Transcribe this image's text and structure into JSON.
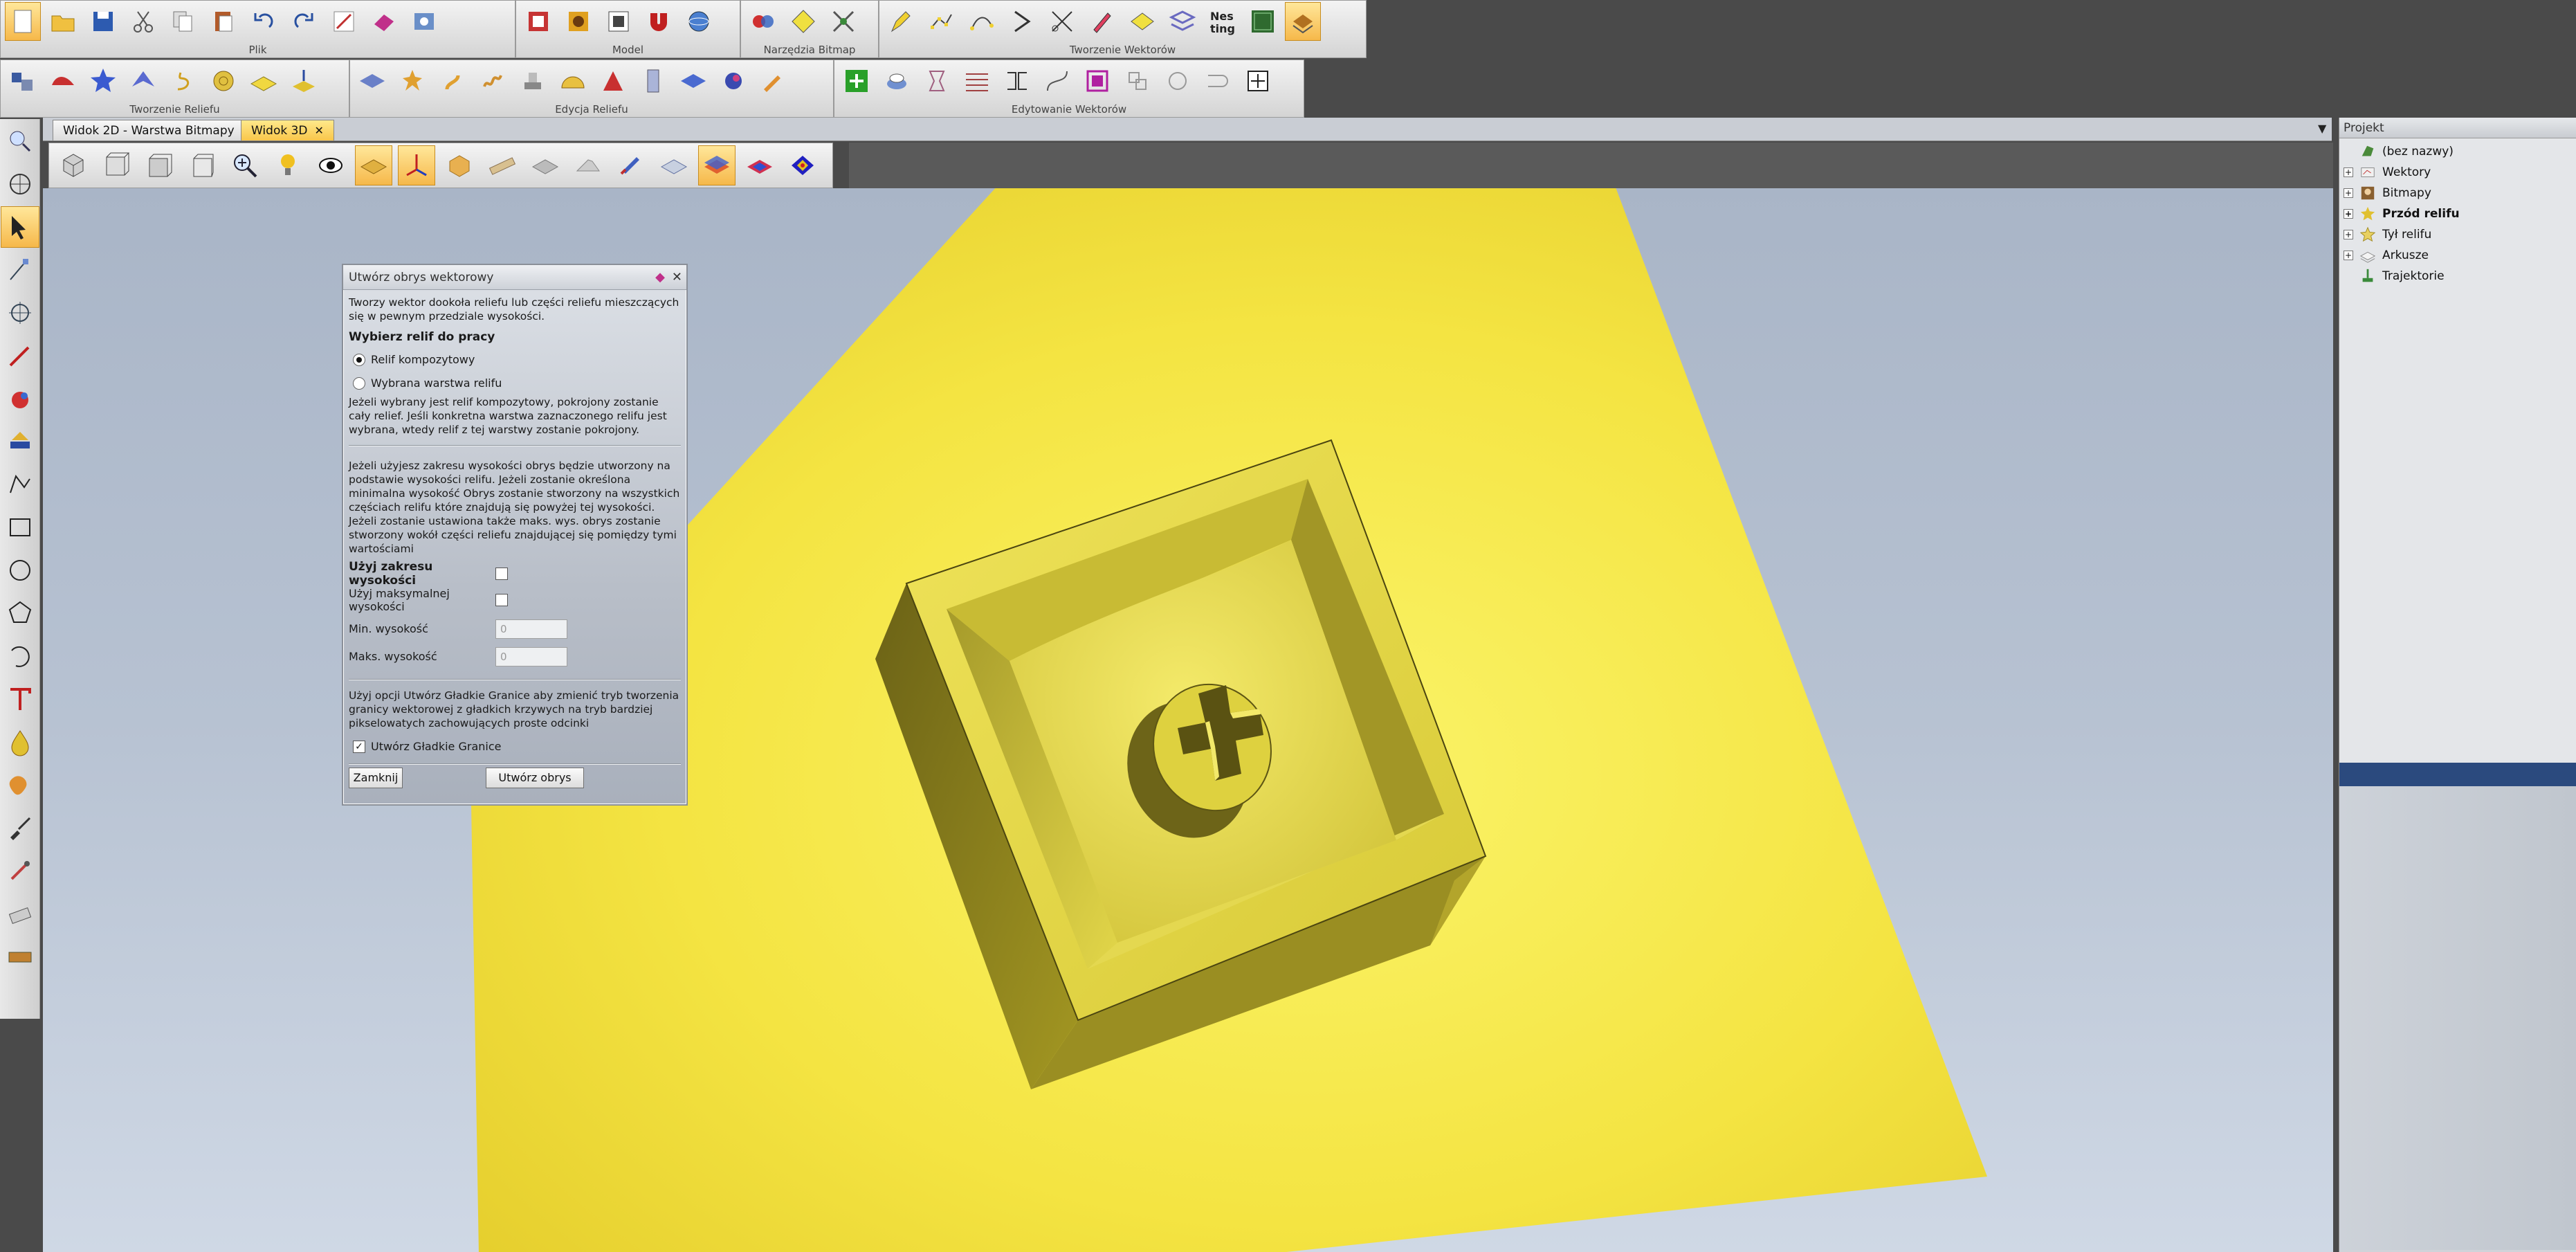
{
  "toolbar_top": {
    "groups": [
      {
        "label": "Plik",
        "icons": [
          "new-file-icon",
          "open-folder-icon",
          "save-icon",
          "cut-icon",
          "copy-icon",
          "paste-icon",
          "undo-icon",
          "redo-icon",
          "edit-icon",
          "eraser-icon",
          "settings-icon"
        ]
      },
      {
        "label": "Model",
        "icons": [
          "model-size-icon",
          "model-resolution-icon",
          "model-offset-icon",
          "model-magnet-icon",
          "model-sphere-icon"
        ]
      },
      {
        "label": "Narzędzia Bitmap",
        "icons": [
          "bitmap-color-icon",
          "bitmap-diamond-icon",
          "bitmap-tools-icon"
        ]
      },
      {
        "label": "Tworzenie Wektorów",
        "icons": [
          "vector-pen-icon",
          "vector-nodes-icon",
          "vector-path-icon",
          "vector-arrow-icon",
          "vector-cut-icon",
          "vector-draw-icon",
          "vector-shape-icon",
          "vector-weave-icon",
          "nesting-icon",
          "vector-text-icon",
          "vector-relief-icon"
        ]
      }
    ],
    "nesting_label": "Nes ting"
  },
  "toolbar_second": {
    "groups": [
      {
        "label": "Tworzenie Reliefu",
        "icons": [
          "relief-shapes-icon",
          "relief-wave-icon",
          "relief-star-icon",
          "relief-swept-icon",
          "relief-spiral-icon",
          "relief-texture-icon",
          "relief-plane-icon",
          "relief-extrude-icon"
        ]
      },
      {
        "label": "Edycja Reliefu",
        "icons": [
          "relief-flat-icon",
          "relief-sculpt-icon",
          "relief-smooth-icon",
          "relief-bevel-icon",
          "relief-stamp-icon",
          "relief-dome-icon",
          "relief-tilt-icon",
          "relief-pillar-icon",
          "relief-layer-icon",
          "relief-blend-icon",
          "relief-brush-icon"
        ]
      },
      {
        "label": "Edytowanie Wektorów",
        "icons": [
          "vector-boundary-icon",
          "vector-ring-icon",
          "vector-transform-icon",
          "vector-pattern-icon",
          "vector-join-icon",
          "vector-spline-icon",
          "vector-group-icon",
          "vector-intersect-icon",
          "vector-circle-icon",
          "vector-weld-icon",
          "vector-select-icon"
        ]
      }
    ]
  },
  "left_toolbar": {
    "icons": [
      "zoom-view-icon",
      "globe-icon",
      "select-arrow-icon",
      "node-edit-icon",
      "transform-icon",
      "pen-line-icon",
      "paint-bucket-icon",
      "paint-fill-icon",
      "polyline-icon",
      "rectangle-icon",
      "circle-icon",
      "polygon-icon",
      "arc-icon",
      "text-icon",
      "drop-icon",
      "blob-icon",
      "brush-icon",
      "dropper-icon",
      "eraser-icon",
      "ruler-icon"
    ]
  },
  "document_tabs": [
    {
      "label": "Widok 2D - Warstwa Bitmapy",
      "active": false
    },
    {
      "label": "Widok 3D",
      "active": true
    }
  ],
  "view3d_toolbar": {
    "icons": [
      "view-iso-icon",
      "view-top-icon",
      "view-front-icon",
      "view-side-icon",
      "zoom-icon",
      "light-icon",
      "eye-icon",
      "relief-shaded-icon",
      "axes-icon",
      "relief-box-icon",
      "ruler-bar-icon",
      "plane-icon",
      "gray-plane-icon",
      "brush-view-icon",
      "material-icon",
      "color-layer-icon",
      "rainbow-layer-icon",
      "rainbow-diamond-icon"
    ],
    "active_icons": [
      "relief-shaded-icon",
      "axes-icon",
      "color-layer-icon"
    ]
  },
  "dialog": {
    "title": "Utwórz obrys wektorowy",
    "intro": "Tworzy wektor dookoła reliefu lub części reliefu mieszczących się w pewnym przedziale wysokości.",
    "select_heading": "Wybierz relif do pracy",
    "radio_composite": "Relif kompozytowy",
    "radio_layer": "Wybrana warstwa relifu",
    "radio_selected": "composite",
    "select_info": "Jeżeli wybrany jest relif kompozytowy, pokrojony zostanie cały relief. Jeśli konkretna warstwa zaznaczonego relifu jest wybrana, wtedy relif z tej warstwy zostanie pokrojony.",
    "range_info": "Jeżeli użyjesz zakresu wysokości obrys będzie utworzony na podstawie wysokości relifu. Jeżeli zostanie określona minimalna wysokość Obrys zostanie stworzony na wszystkich częściach relifu które znajdują się powyżej tej wysokości. Jeżeli zostanie ustawiona także maks. wys. obrys zostanie stworzony wokół części reliefu znajdującej się pomiędzy tymi wartościami",
    "use_range_label": "Użyj zakresu wysokości",
    "use_range_checked": false,
    "use_max_label": "Użyj maksymalnej wysokości",
    "use_max_checked": false,
    "min_label": "Min. wysokość",
    "min_value": "0",
    "max_label": "Maks. wysokość",
    "max_value": "0",
    "smooth_info": "Użyj opcji Utwórz Gładkie Granice aby zmienić tryb tworzenia granicy wektorowej z gładkich krzywych na tryb bardziej pikselowatych zachowujących proste odcinki",
    "smooth_label": "Utwórz Gładkie Granice",
    "smooth_checked": true,
    "close_button": "Zamknij",
    "create_button": "Utwórz obrys"
  },
  "project_panel": {
    "title": "Projekt",
    "items": [
      {
        "label": "(bez nazwy)",
        "bold": false,
        "expandable": false,
        "icon": "project-root-icon"
      },
      {
        "label": "Wektory",
        "bold": false,
        "expandable": true,
        "icon": "vectors-folder-icon"
      },
      {
        "label": "Bitmapy",
        "bold": false,
        "expandable": true,
        "icon": "bitmaps-folder-icon"
      },
      {
        "label": "Przód relifu",
        "bold": true,
        "expandable": true,
        "icon": "relief-front-icon"
      },
      {
        "label": "Tył relifu",
        "bold": false,
        "expandable": true,
        "icon": "relief-back-icon"
      },
      {
        "label": "Arkusze",
        "bold": false,
        "expandable": true,
        "icon": "sheets-folder-icon"
      },
      {
        "label": "Trajektorie",
        "bold": false,
        "expandable": false,
        "icon": "toolpaths-icon"
      }
    ]
  },
  "colors": {
    "relief_yellow": "#f2e23a",
    "relief_shadow": "#8f8420",
    "panel_selection": "#2b4a7e",
    "tab_active": "#f9c64a"
  }
}
